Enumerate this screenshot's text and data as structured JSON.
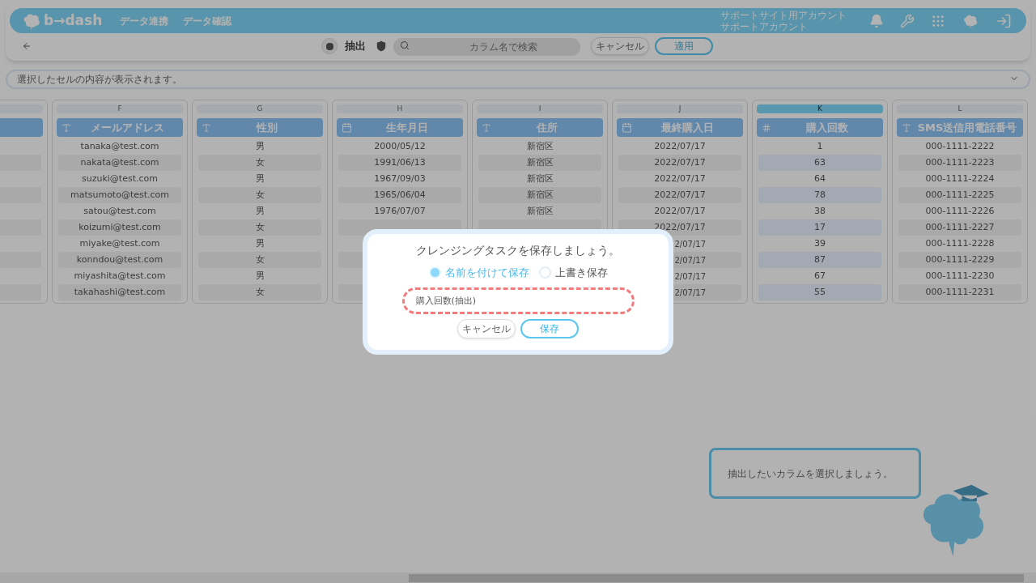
{
  "header": {
    "logo": "b→dash",
    "nav": [
      "データ連携",
      "データ確認"
    ],
    "account": [
      "サポートサイト用アカウント",
      "サポートアカウント"
    ]
  },
  "toolbar": {
    "mode": "抽出",
    "search": {
      "placeholder": "カラム名で検索"
    },
    "buttons": [
      {
        "label": "キャンセル",
        "kind": "secondary"
      },
      {
        "label": "適用",
        "kind": "primary"
      }
    ]
  },
  "cell_preview": {
    "placeholder": "選択したセルの内容が表示されます。"
  },
  "columns": [
    {
      "letter": "F",
      "name": "メールアドレス",
      "kind": "text",
      "selected": false,
      "cells": [
        "tanaka@test.com",
        "nakata@test.com",
        "suzuki@test.com",
        "matsumoto@test.com",
        "satou@test.com",
        "koizumi@test.com",
        "miyake@test.com",
        "konndou@test.com",
        "miyashita@test.com",
        "takahashi@test.com"
      ]
    },
    {
      "letter": "G",
      "name": "性別",
      "kind": "text",
      "selected": false,
      "cells": [
        "男",
        "女",
        "男",
        "女",
        "男",
        "女",
        "男",
        "女",
        "男",
        "女"
      ]
    },
    {
      "letter": "H",
      "name": "生年月日",
      "kind": "date",
      "selected": false,
      "cells": [
        "2000/05/12",
        "1991/06/13",
        "1967/09/03",
        "1965/06/04",
        "1976/07/07",
        null,
        null,
        null,
        null,
        null
      ]
    },
    {
      "letter": "I",
      "name": "住所",
      "kind": "text",
      "selected": false,
      "cells": [
        "新宿区",
        "新宿区",
        "新宿区",
        "新宿区",
        "新宿区",
        null,
        null,
        null,
        null,
        null
      ]
    },
    {
      "letter": "J",
      "name": "最終購入日",
      "kind": "date",
      "selected": false,
      "cells": [
        "2022/07/17",
        "2022/07/17",
        "2022/07/17",
        "2022/07/17",
        "2022/07/17",
        "2022/07/17",
        {
          "text": "2/07/17",
          "cut": true
        },
        {
          "text": "2/07/17",
          "cut": true
        },
        {
          "text": "2/07/17",
          "cut": true
        },
        {
          "text": "2/07/17",
          "cut": true
        }
      ]
    },
    {
      "letter": "K",
      "name": "購入回数",
      "kind": "number",
      "selected": true,
      "cells": [
        "1",
        "63",
        "64",
        "78",
        "38",
        "17",
        "39",
        "87",
        "67",
        "55"
      ]
    },
    {
      "letter": "L",
      "name": "SMS送信用電話番号",
      "kind": "text",
      "selected": false,
      "cells": [
        "000-1111-2222",
        "000-1111-2223",
        "000-1111-2224",
        "000-1111-2225",
        "000-1111-2226",
        "000-1111-2227",
        "000-1111-2228",
        "000-1111-2229",
        "000-1111-2230",
        "000-1111-2231"
      ]
    }
  ],
  "dialog": {
    "title": "クレンジングタスクを保存しましょう。",
    "options": [
      {
        "label": "名前を付けて保存",
        "selected": true
      },
      {
        "label": "上書き保存",
        "selected": false
      }
    ],
    "name_field": {
      "value": "購入回数(抽出)",
      "highlighted": true
    },
    "buttons": [
      {
        "label": "キャンセル",
        "kind": "secondary"
      },
      {
        "label": "保存",
        "kind": "primary"
      }
    ]
  },
  "hint": {
    "text": "抽出したいカラムを選択しましょう。"
  }
}
